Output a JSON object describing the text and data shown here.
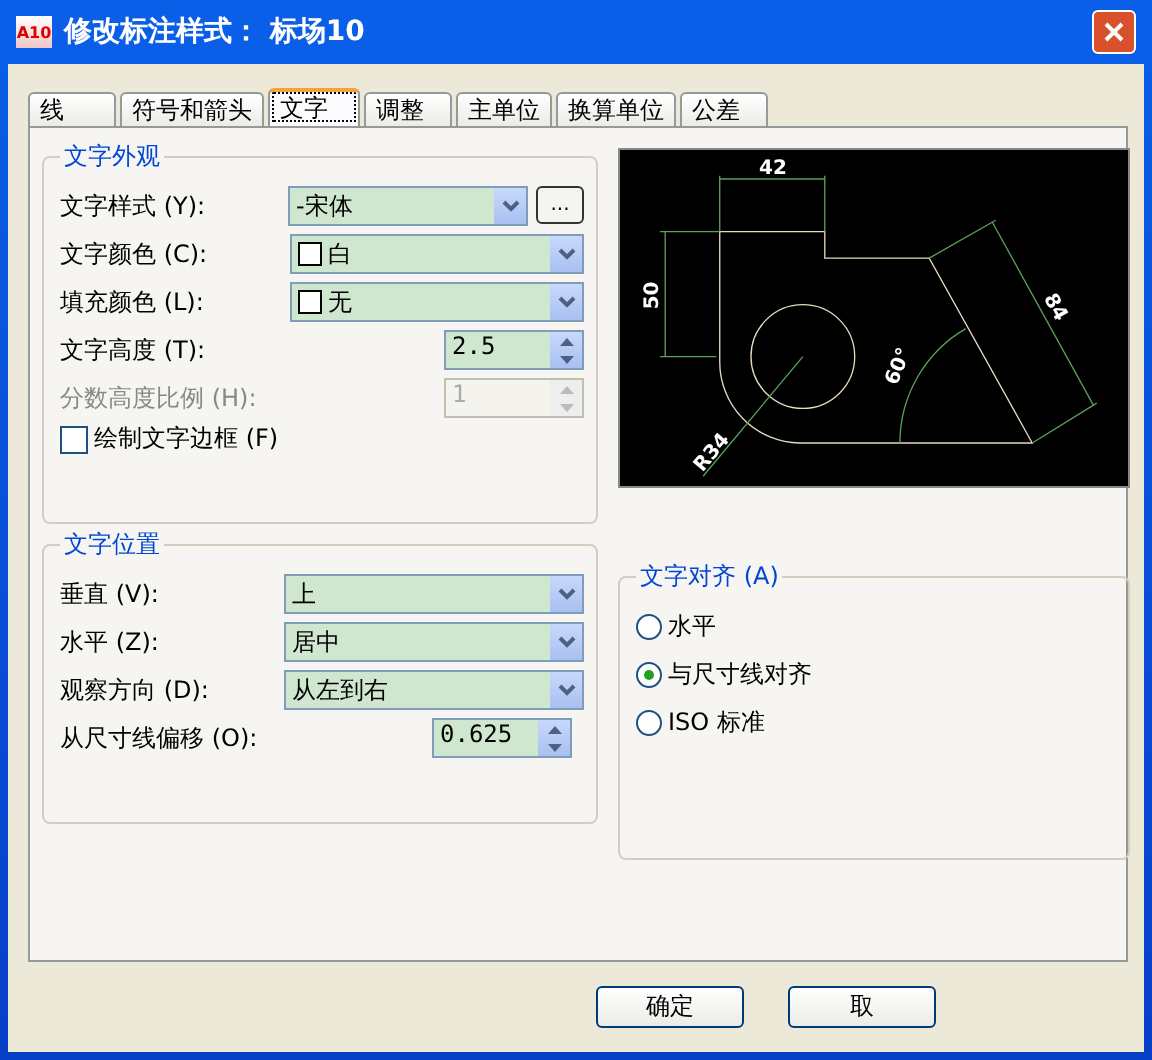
{
  "window": {
    "title": "修改标注样式： 标场10",
    "icon_text": "A10"
  },
  "tabs": [
    {
      "label": "线",
      "selected": false
    },
    {
      "label": "符号和箭头",
      "selected": false
    },
    {
      "label": "文字",
      "selected": true
    },
    {
      "label": "调整",
      "selected": false
    },
    {
      "label": "主单位",
      "selected": false
    },
    {
      "label": "换算单位",
      "selected": false
    },
    {
      "label": "公差",
      "selected": false
    }
  ],
  "appearance": {
    "title": "文字外观",
    "rows": [
      {
        "kind": "combo",
        "label": "文字样式 (Y):",
        "value": "-宋体",
        "browse": "..."
      },
      {
        "kind": "combo",
        "label": "文字颜色 (C):",
        "value": "白",
        "swatch": true
      },
      {
        "kind": "combo",
        "label": "填充颜色 (L):",
        "value": "无",
        "swatch": true
      },
      {
        "kind": "spin",
        "label": "文字高度 (T):",
        "value": "2.5"
      },
      {
        "kind": "spin",
        "label": "分数高度比例 (H):",
        "value": "1",
        "disabled": true
      },
      {
        "kind": "check",
        "label": "绘制文字边框 (F)",
        "checked": false
      }
    ]
  },
  "placement": {
    "title": "文字位置",
    "rows": [
      {
        "kind": "combo",
        "label": "垂直 (V):",
        "value": "上"
      },
      {
        "kind": "combo",
        "label": "水平 (Z):",
        "value": "居中"
      },
      {
        "kind": "combo",
        "label": "观察方向 (D):",
        "value": "从左到右"
      },
      {
        "kind": "spin",
        "label": "从尺寸线偏移 (O):",
        "value": "0.625"
      }
    ]
  },
  "preview": {
    "labels": [
      "42",
      "50",
      "84",
      "60°",
      "R34"
    ]
  },
  "alignment": {
    "title": "文字对齐 (A)",
    "options": [
      {
        "label": "水平",
        "selected": false
      },
      {
        "label": "与尺寸线对齐",
        "selected": true
      },
      {
        "label": "ISO 标准",
        "selected": false
      }
    ]
  },
  "buttons": [
    "确定",
    "取"
  ]
}
